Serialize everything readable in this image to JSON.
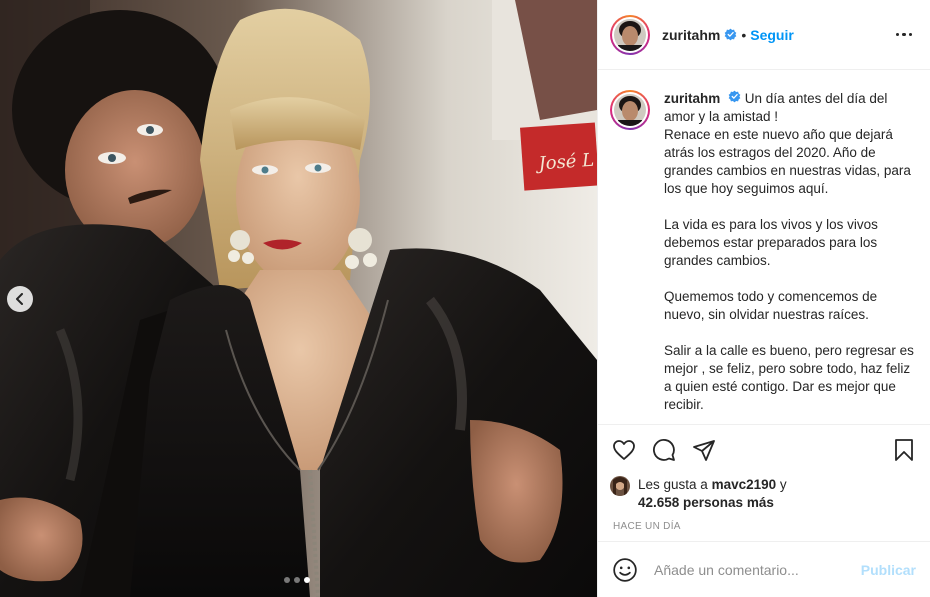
{
  "header": {
    "username": "zuritahm",
    "separator": "•",
    "follow_label": "Seguir"
  },
  "caption": {
    "username": "zuritahm",
    "paragraphs": [
      "Un día antes del día del amor y la amistad !\nRenace en este nuevo año que dejará atrás los estragos del 2020. Año de grandes cambios en nuestras vidas, para los que hoy seguimos aquí.",
      "La vida es para los vivos y los vivos debemos estar preparados para los grandes cambios.",
      "Quememos todo y comencemos de nuevo, sin olvidar nuestras raíces.",
      "Salir a la calle es bueno, pero regresar es mejor , se feliz, pero sobre todo, haz feliz a quien esté contigo. Dar es mejor que recibir."
    ]
  },
  "likes": {
    "prefix": "Les gusta a",
    "user": "mavc2190",
    "connector": "y",
    "count": "42.658 personas más"
  },
  "timestamp": "HACE UN DÍA",
  "comment_box": {
    "placeholder": "Añade un comentario...",
    "publish_label": "Publicar"
  },
  "photo": {
    "poster_text": "José L",
    "carousel_index": 3,
    "carousel_total": 3
  },
  "colors": {
    "accent": "#0095f6",
    "publish_disabled": "#b2dffc",
    "muted": "#8e8e8e",
    "verified": "#3897f0"
  },
  "icons": [
    "chevron-left-icon",
    "more-icon",
    "verified-icon",
    "heart-icon",
    "comment-icon",
    "share-icon",
    "bookmark-icon",
    "emoji-icon"
  ]
}
